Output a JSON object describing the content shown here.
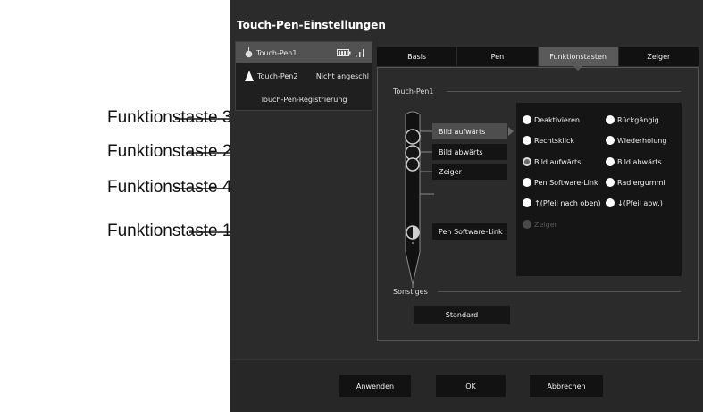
{
  "callouts": [
    {
      "label": "Funktionstaste 3"
    },
    {
      "label": "Funktionstaste 2"
    },
    {
      "label": "Funktionstaste 4"
    },
    {
      "label": "Funktionstaste 1"
    }
  ],
  "dialog": {
    "title": "Touch-Pen-Einstellungen",
    "pens": [
      {
        "name": "Touch-Pen1",
        "status": "",
        "icon": "pen-round-icon",
        "battery_icon": "battery-icon",
        "signal_icon": "signal-icon",
        "selected": true
      },
      {
        "name": "Touch-Pen2",
        "status": "Nicht angeschl",
        "icon": "pen-triangle-icon",
        "selected": false
      }
    ],
    "registration_label": "Touch-Pen-Registrierung",
    "tabs": [
      {
        "label": "Basis",
        "active": false
      },
      {
        "label": "Pen",
        "active": false
      },
      {
        "label": "Funktionstasten",
        "active": true
      },
      {
        "label": "Zeiger",
        "active": false
      }
    ],
    "section_pen_label": "Touch-Pen1",
    "function_buttons": [
      {
        "label": "Bild aufwärts",
        "selected": true
      },
      {
        "label": "Bild abwärts",
        "selected": false
      },
      {
        "label": "Zeiger",
        "selected": false
      },
      {
        "label": "Pen Software-Link",
        "selected": false
      }
    ],
    "options": [
      {
        "label": "Deaktivieren",
        "checked": false,
        "disabled": false
      },
      {
        "label": "Rückgängig",
        "checked": false,
        "disabled": false
      },
      {
        "label": "Rechtsklick",
        "checked": false,
        "disabled": false
      },
      {
        "label": "Wiederholung",
        "checked": false,
        "disabled": false
      },
      {
        "label": "Bild aufwärts",
        "checked": true,
        "disabled": false
      },
      {
        "label": "Bild abwärts",
        "checked": false,
        "disabled": false
      },
      {
        "label": "Pen Software-Link",
        "checked": false,
        "disabled": false
      },
      {
        "label": "Radiergummi",
        "checked": false,
        "disabled": false
      },
      {
        "label": "↑(Pfeil nach oben)",
        "checked": false,
        "disabled": false
      },
      {
        "label": "↓(Pfeil abw.)",
        "checked": false,
        "disabled": false
      },
      {
        "label": "Zeiger",
        "checked": false,
        "disabled": true
      }
    ],
    "section_other_label": "Sonstiges",
    "standard_label": "Standard",
    "footer": {
      "apply": "Anwenden",
      "ok": "OK",
      "cancel": "Abbrechen"
    }
  },
  "colors": {
    "dialog_bg": "#2b2b2b",
    "tab_active": "#5a5a5a",
    "panel_dark": "#151515",
    "text": "#f0f0f0"
  }
}
